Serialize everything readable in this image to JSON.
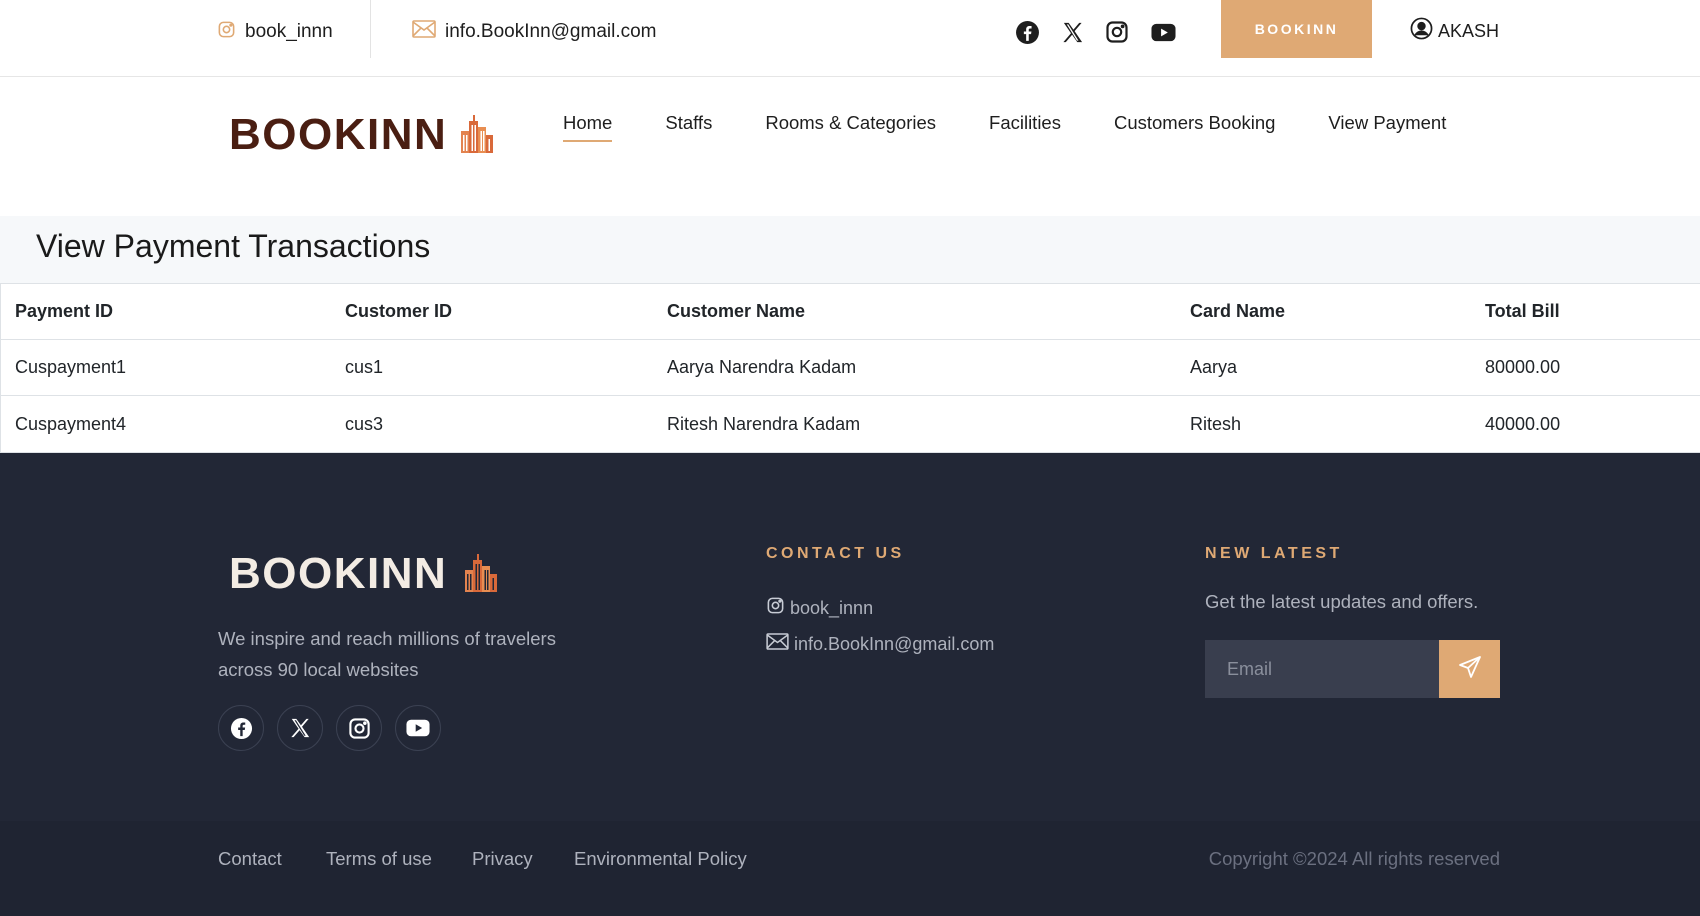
{
  "topbar": {
    "instagram_handle": "book_innn",
    "email": "info.BookInn@gmail.com",
    "social_icons": [
      "facebook-icon",
      "x-icon",
      "instagram-icon",
      "youtube-icon"
    ],
    "book_button_label": "BOOKINN",
    "user_name": "AKASH"
  },
  "header": {
    "logo_text": "BOOKINN",
    "nav": [
      {
        "label": "Home",
        "active": true
      },
      {
        "label": "Staffs"
      },
      {
        "label": "Rooms & Categories"
      },
      {
        "label": "Facilities"
      },
      {
        "label": "Customers Booking"
      },
      {
        "label": "View Payment"
      }
    ]
  },
  "page_title": "View Payment Transactions",
  "table": {
    "headers": [
      "Payment ID",
      "Customer ID",
      "Customer Name",
      "Card Name",
      "Total Bill"
    ],
    "rows": [
      [
        "Cuspayment1",
        "cus1",
        "Aarya Narendra Kadam",
        "Aarya",
        "80000.00"
      ],
      [
        "Cuspayment4",
        "cus3",
        "Ritesh Narendra Kadam",
        "Ritesh",
        "40000.00"
      ]
    ]
  },
  "footer": {
    "logo_text": "BOOKINN",
    "description": "We inspire and reach millions of travelers across 90 local websites",
    "contact_heading": "CONTACT US",
    "contact_instagram": "book_innn",
    "contact_email": "info.BookInn@gmail.com",
    "news_heading": "NEW LATEST",
    "news_text": "Get the latest updates and offers.",
    "email_placeholder": "Email",
    "links": [
      "Contact",
      "Terms of use",
      "Privacy",
      "Environmental Policy"
    ],
    "copyright": "Copyright ©2024 All rights reserved"
  },
  "colors": {
    "accent": "#dfa974",
    "logo_dark": "#4a1e12",
    "footer_bg": "#222736"
  }
}
